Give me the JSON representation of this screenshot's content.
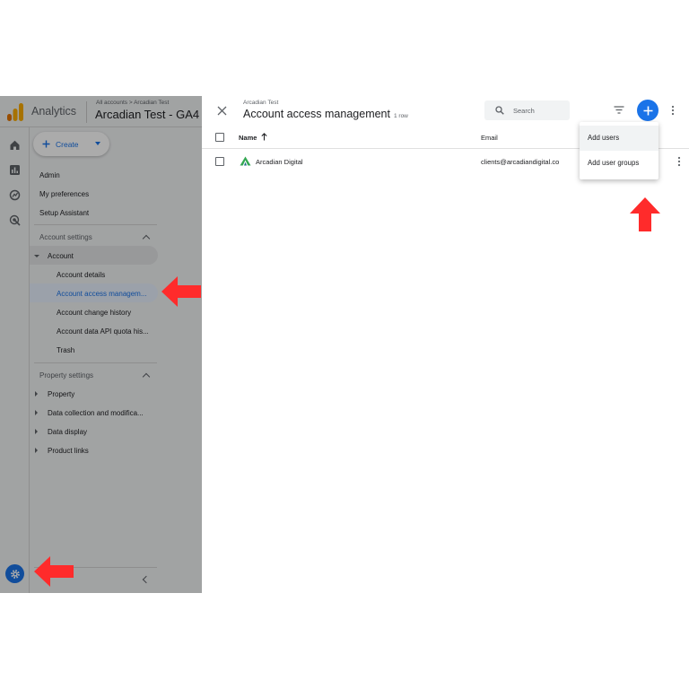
{
  "app": {
    "product": "Analytics",
    "breadcrumb": "All accounts > Arcadian Test",
    "property_title": "Arcadian Test - GA4"
  },
  "create_button": {
    "label": "Create"
  },
  "nav": {
    "admin": "Admin",
    "my_preferences": "My preferences",
    "setup_assistant": "Setup Assistant",
    "account_settings": "Account settings",
    "account": "Account",
    "account_items": [
      "Account details",
      "Account access managem...",
      "Account change history",
      "Account data API quota his...",
      "Trash"
    ],
    "property_settings": "Property settings",
    "property_items": [
      "Property",
      "Data collection and modifica...",
      "Data display",
      "Product links"
    ]
  },
  "drawer": {
    "breadcrumb": "Arcadian Test",
    "title": "Account access management",
    "row_count": "1 row",
    "search_placeholder": "Search",
    "columns": {
      "name": "Name",
      "email": "Email"
    },
    "rows": [
      {
        "name": "Arcadian Digital",
        "email": "clients@arcadiandigital.co"
      }
    ]
  },
  "add_menu": {
    "items": [
      "Add users",
      "Add user groups"
    ]
  },
  "colors": {
    "accent": "#1a73e8",
    "arrow": "#ff2b2b",
    "logo_orange": "#f9ab00",
    "logo_dark_orange": "#e37400"
  }
}
